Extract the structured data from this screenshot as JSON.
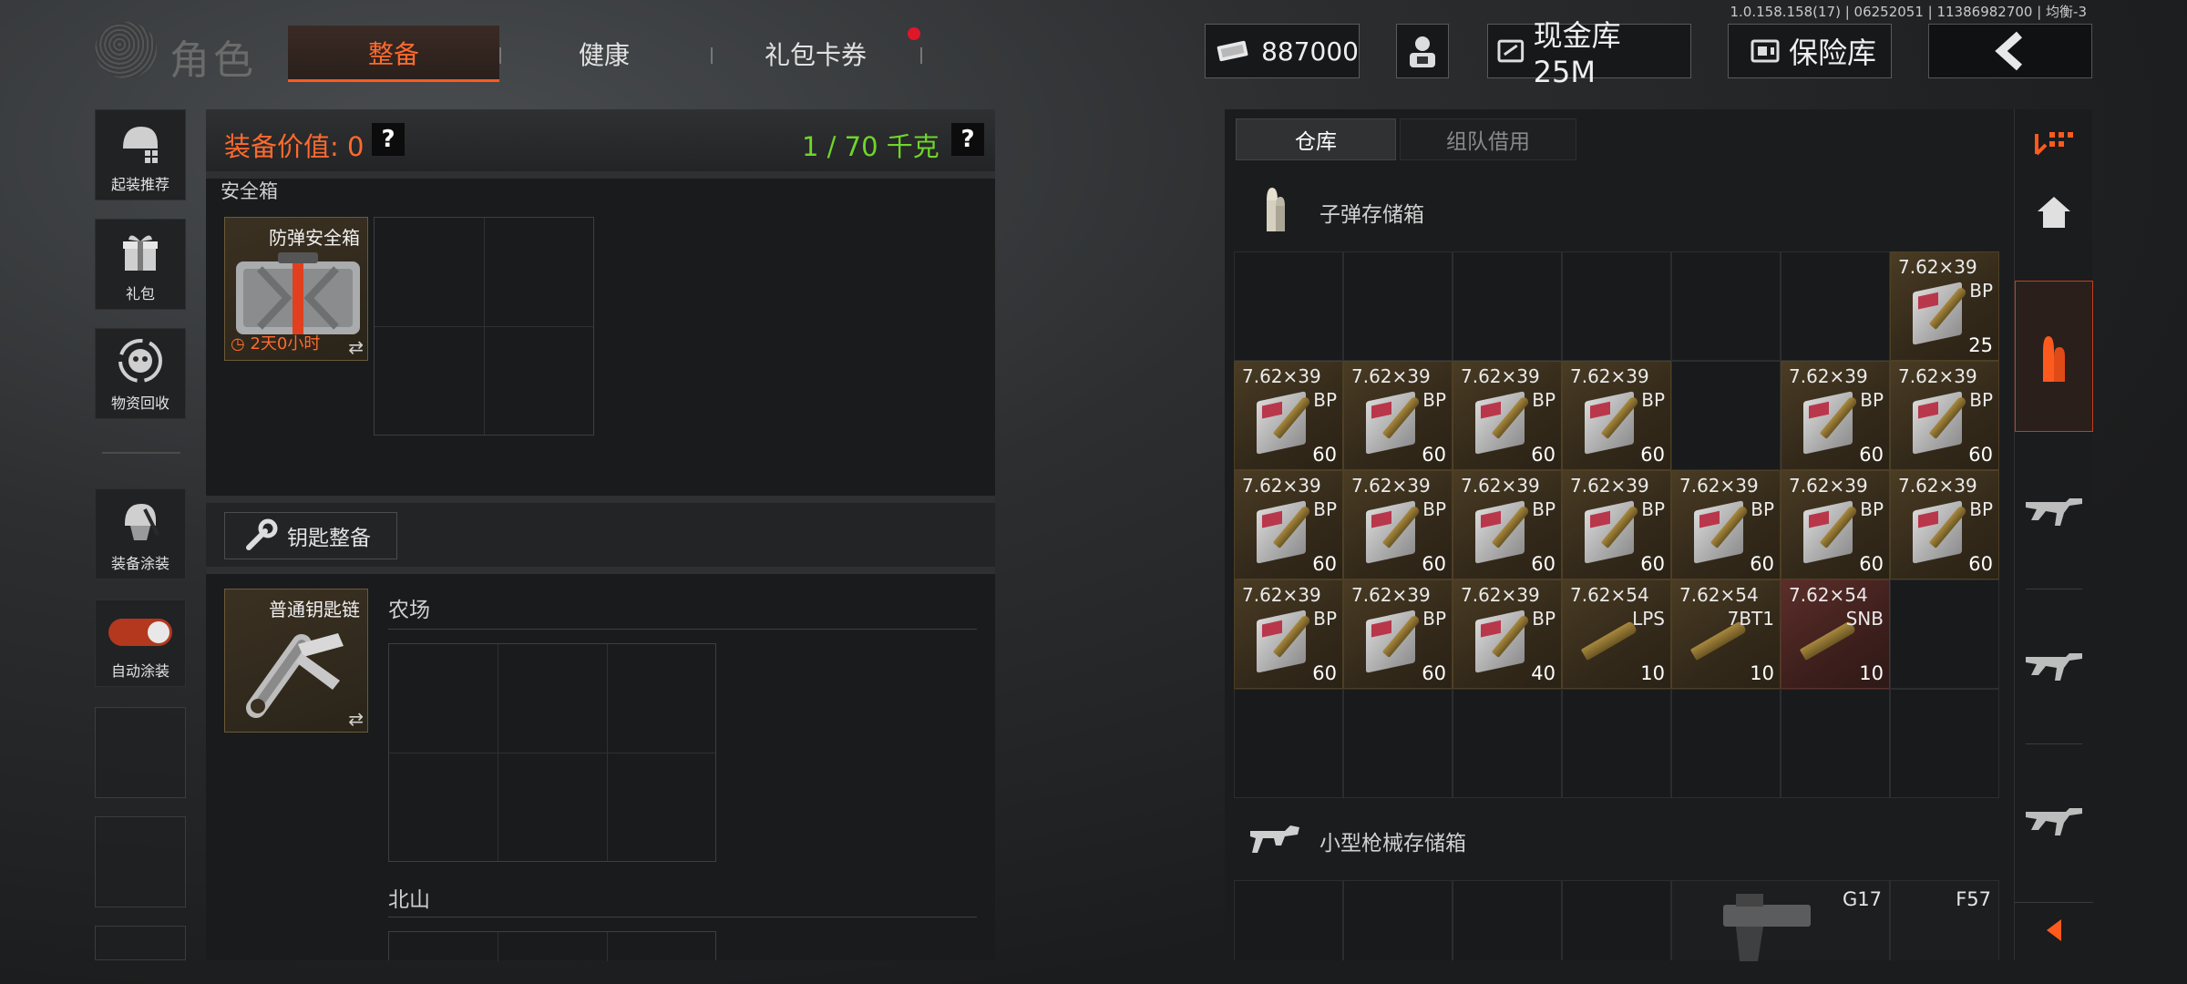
{
  "version_text": "1.0.158.158(17) | 06252051 | 11386982700 | 均衡-3",
  "header": {
    "title": "角色",
    "tabs": [
      {
        "label": "整备",
        "active": true
      },
      {
        "label": "健康",
        "active": false
      },
      {
        "label": "礼包卡券",
        "active": false,
        "notification": true
      }
    ],
    "money": "887000",
    "cash_vault": "现金库 25M",
    "safe": "保险库"
  },
  "sidebar": {
    "items": [
      {
        "label": "起装推荐",
        "icon": "helmet-icon"
      },
      {
        "label": "礼包",
        "icon": "gift-icon"
      },
      {
        "label": "物资回收",
        "icon": "recycle-icon"
      },
      {
        "label": "装备涂装",
        "icon": "skin-icon"
      },
      {
        "label": "自动涂装",
        "icon": "toggle-icon",
        "toggle_on": true
      }
    ]
  },
  "loadout": {
    "value_label": "装备价值: 0",
    "weight_label": "1 / 70 千克",
    "help": "?",
    "safe_box_section": "安全箱",
    "safe_box_item": {
      "name": "防弹安全箱",
      "timer": "2天0小时"
    },
    "key_button": "钥匙整备",
    "keychain_item": {
      "name": "普通钥匙链"
    },
    "key_sections": [
      "农场",
      "北山"
    ]
  },
  "storage": {
    "tabs": [
      {
        "label": "仓库",
        "active": true
      },
      {
        "label": "组队借用",
        "active": false
      }
    ],
    "ammo_section": "子弹存储箱",
    "ammo_items": [
      {
        "row": 0,
        "col": 6,
        "caliber": "7.62×39",
        "type": "BP",
        "count": "25",
        "rarity": "gold"
      },
      {
        "row": 1,
        "col": 0,
        "caliber": "7.62×39",
        "type": "BP",
        "count": "60",
        "rarity": "gold"
      },
      {
        "row": 1,
        "col": 1,
        "caliber": "7.62×39",
        "type": "BP",
        "count": "60",
        "rarity": "gold"
      },
      {
        "row": 1,
        "col": 2,
        "caliber": "7.62×39",
        "type": "BP",
        "count": "60",
        "rarity": "gold"
      },
      {
        "row": 1,
        "col": 3,
        "caliber": "7.62×39",
        "type": "BP",
        "count": "60",
        "rarity": "gold"
      },
      {
        "row": 1,
        "col": 5,
        "caliber": "7.62×39",
        "type": "BP",
        "count": "60",
        "rarity": "gold"
      },
      {
        "row": 1,
        "col": 6,
        "caliber": "7.62×39",
        "type": "BP",
        "count": "60",
        "rarity": "gold"
      },
      {
        "row": 2,
        "col": 0,
        "caliber": "7.62×39",
        "type": "BP",
        "count": "60",
        "rarity": "gold"
      },
      {
        "row": 2,
        "col": 1,
        "caliber": "7.62×39",
        "type": "BP",
        "count": "60",
        "rarity": "gold"
      },
      {
        "row": 2,
        "col": 2,
        "caliber": "7.62×39",
        "type": "BP",
        "count": "60",
        "rarity": "gold"
      },
      {
        "row": 2,
        "col": 3,
        "caliber": "7.62×39",
        "type": "BP",
        "count": "60",
        "rarity": "gold"
      },
      {
        "row": 2,
        "col": 4,
        "caliber": "7.62×39",
        "type": "BP",
        "count": "60",
        "rarity": "gold"
      },
      {
        "row": 2,
        "col": 5,
        "caliber": "7.62×39",
        "type": "BP",
        "count": "60",
        "rarity": "gold"
      },
      {
        "row": 2,
        "col": 6,
        "caliber": "7.62×39",
        "type": "BP",
        "count": "60",
        "rarity": "gold"
      },
      {
        "row": 3,
        "col": 0,
        "caliber": "7.62×39",
        "type": "BP",
        "count": "60",
        "rarity": "gold"
      },
      {
        "row": 3,
        "col": 1,
        "caliber": "7.62×39",
        "type": "BP",
        "count": "60",
        "rarity": "gold"
      },
      {
        "row": 3,
        "col": 2,
        "caliber": "7.62×39",
        "type": "BP",
        "count": "40",
        "rarity": "gold"
      },
      {
        "row": 3,
        "col": 3,
        "caliber": "7.62×54",
        "type": "LPS",
        "count": "10",
        "rarity": "gold",
        "single": true
      },
      {
        "row": 3,
        "col": 4,
        "caliber": "7.62×54",
        "type": "7BT1",
        "count": "10",
        "rarity": "gold",
        "single": true
      },
      {
        "row": 3,
        "col": 5,
        "caliber": "7.62×54",
        "type": "SNB",
        "count": "10",
        "rarity": "red",
        "single": true
      }
    ],
    "gun_section": "小型枪械存储箱",
    "gun_items": [
      "G17",
      "F57"
    ]
  },
  "right_nav": [
    "filter-icon",
    "home-icon",
    "ammo-icon",
    "rifle-icon",
    "rifle-icon",
    "rifle-icon",
    "collapse-icon"
  ],
  "colors": {
    "accent": "#ff5a1e",
    "weight": "#6fd62a",
    "notification": "#e0162b"
  }
}
